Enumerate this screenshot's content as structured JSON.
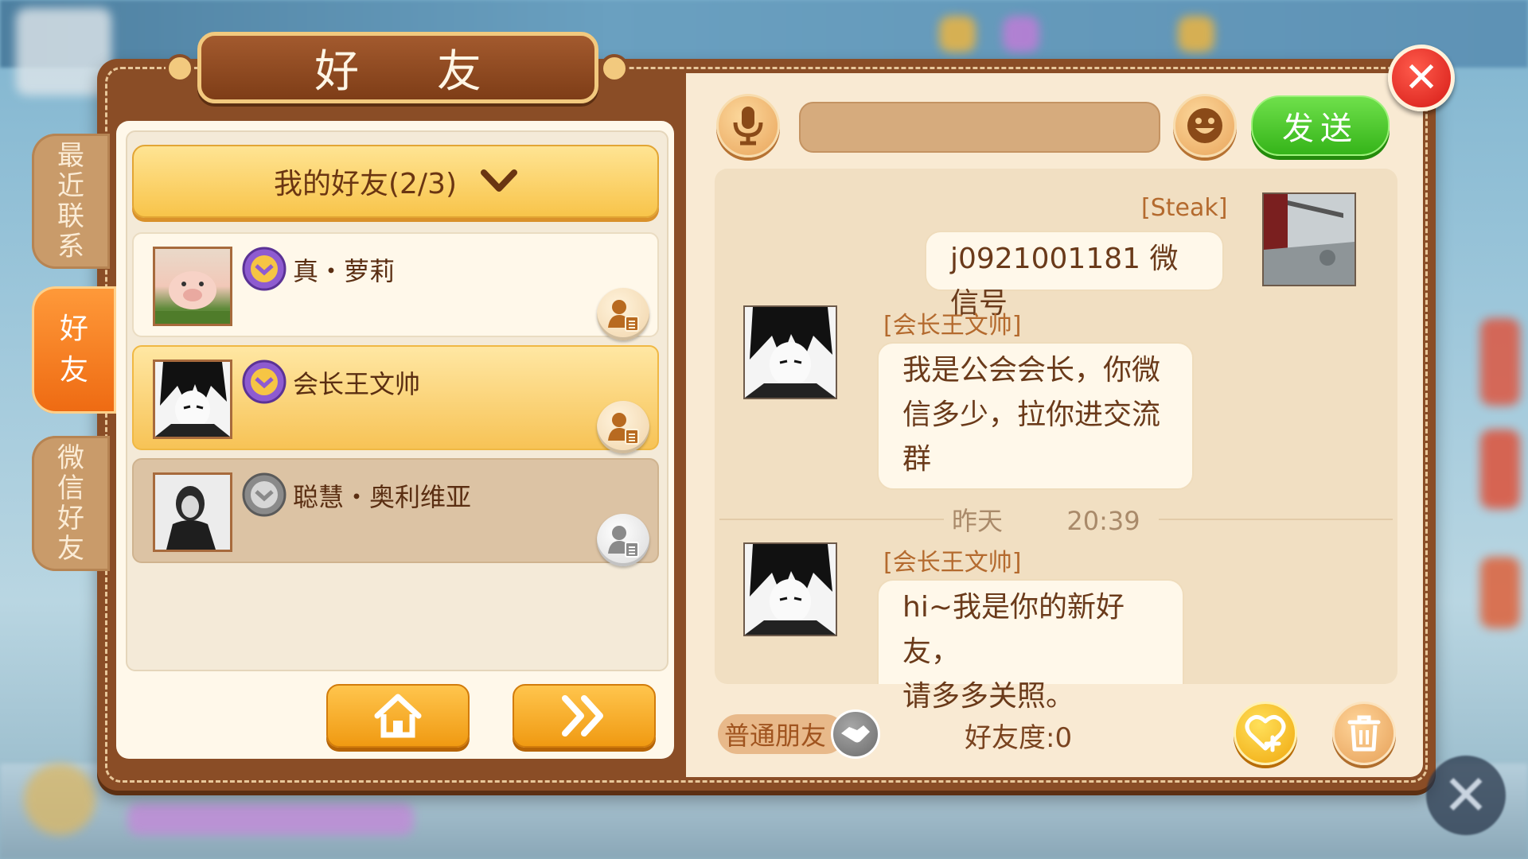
{
  "window": {
    "title": "好 友"
  },
  "side_tabs": [
    {
      "label": "最近联系",
      "active": false
    },
    {
      "label": "好友",
      "active": true
    },
    {
      "label": "微信好友",
      "active": false
    }
  ],
  "friend_group": {
    "label": "我的好友(2/3)"
  },
  "friends": [
    {
      "name": "真・萝莉",
      "online": true
    },
    {
      "name": "会长王文帅",
      "online": true,
      "selected": true
    },
    {
      "name": "聪慧・奥利维亚",
      "online": false
    }
  ],
  "chat": {
    "send_label": "发送",
    "messages": [
      {
        "sender": "[Steak]",
        "text": "j0921001181 微信号",
        "side": "right"
      },
      {
        "sender": "[会长王文帅]",
        "lines": [
          "我是公会会长，你微",
          "信多少，拉你进交流",
          "群"
        ],
        "side": "left"
      },
      {
        "sender": "[会长王文帅]",
        "lines": [
          "hi~我是你的新好友，",
          "请多多关照。"
        ],
        "side": "left"
      }
    ],
    "time_separator": {
      "day": "昨天",
      "time": "20:39"
    }
  },
  "footer": {
    "relation": "普通朋友",
    "intimacy": "好友度:0"
  },
  "colors": {
    "panel_brown": "#8a4d26",
    "accent_orange": "#f09a12",
    "send_green": "#35b419",
    "close_red": "#d51b16"
  },
  "icons": [
    "microphone-icon",
    "emoji-icon",
    "close-icon",
    "home-icon",
    "double-chevron-icon",
    "friend-detail-icon",
    "handshake-icon",
    "heart-add-icon",
    "trash-icon",
    "chevron-down-icon",
    "guild-badge-icon"
  ]
}
